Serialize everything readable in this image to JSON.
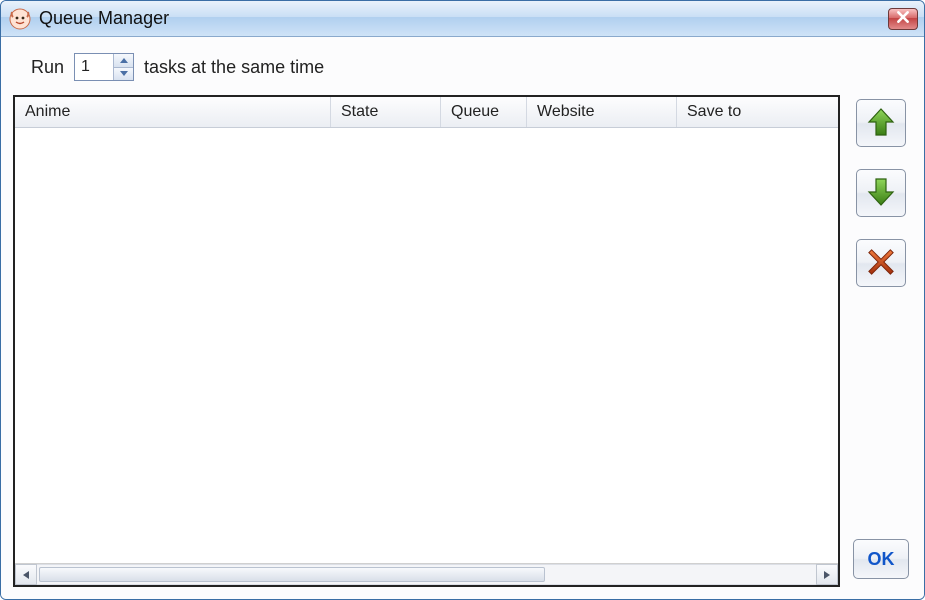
{
  "window": {
    "title": "Queue Manager"
  },
  "controls": {
    "run_label_before": "Run",
    "run_value": "1",
    "run_label_after": "tasks at the same time"
  },
  "table": {
    "columns": {
      "anime": "Anime",
      "state": "State",
      "queue": "Queue",
      "website": "Website",
      "save_to": "Save to"
    },
    "rows": []
  },
  "buttons": {
    "ok": "OK"
  },
  "icons": {
    "move_up": "arrow-up-icon",
    "move_down": "arrow-down-icon",
    "delete": "delete-x-icon",
    "close": "close-icon",
    "app": "app-icon"
  },
  "colors": {
    "green": "#5fae2a",
    "green_dark": "#3a7d14",
    "red": "#d9481f",
    "red_dark": "#a12f0d",
    "blue_text": "#1156c9"
  }
}
